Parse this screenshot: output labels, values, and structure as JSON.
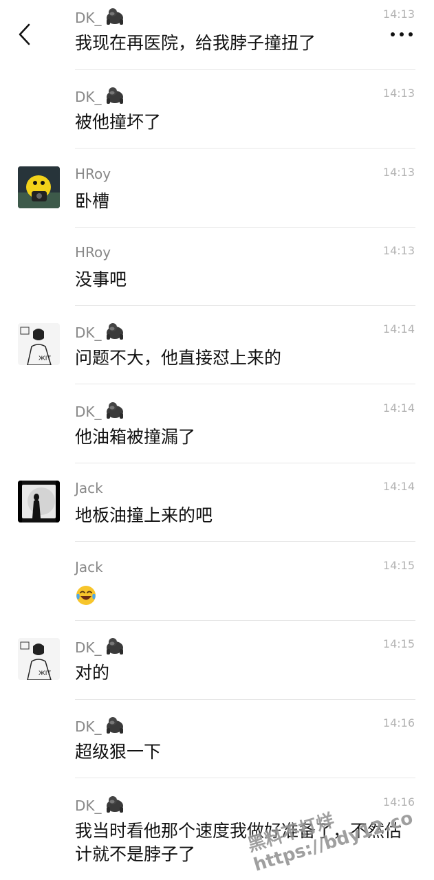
{
  "header": {
    "back_icon": "chevron-left-icon",
    "more_icon": "ellipsis-icon"
  },
  "messages": [
    {
      "sender": "DK_",
      "emoji": "gorilla-icon",
      "time": "14:13",
      "text": "我现在再医院，给我脖子撞扭了"
    },
    {
      "sender": "DK_",
      "emoji": "gorilla-icon",
      "time": "14:13",
      "text": "被他撞坏了"
    },
    {
      "sender": "HRoy",
      "time": "14:13",
      "text": "卧槽",
      "avatar": "hroy-avatar"
    },
    {
      "sender": "HRoy",
      "time": "14:13",
      "text": "没事吧"
    },
    {
      "sender": "DK_",
      "emoji": "gorilla-icon",
      "time": "14:14",
      "text": "问题不大，他直接怼上来的",
      "avatar": "dk-avatar"
    },
    {
      "sender": "DK_",
      "emoji": "gorilla-icon",
      "time": "14:14",
      "text": "他油箱被撞漏了"
    },
    {
      "sender": "Jack",
      "time": "14:14",
      "text": "地板油撞上来的吧",
      "avatar": "jack-avatar"
    },
    {
      "sender": "Jack",
      "time": "14:15",
      "text": "",
      "emoji_body": "laughing-crying-emoji"
    },
    {
      "sender": "DK_",
      "emoji": "gorilla-icon",
      "time": "14:15",
      "text": "对的",
      "avatar": "dk-avatar"
    },
    {
      "sender": "DK_",
      "emoji": "gorilla-icon",
      "time": "14:16",
      "text": "超级狠一下"
    },
    {
      "sender": "DK_",
      "emoji": "gorilla-icon",
      "time": "14:16",
      "text": "我当时看他那个速度我做好准备了，不然估计就不是脖子了"
    }
  ],
  "watermark": {
    "line1": "黑料不打烊",
    "line2": "https://bdy12.co"
  }
}
